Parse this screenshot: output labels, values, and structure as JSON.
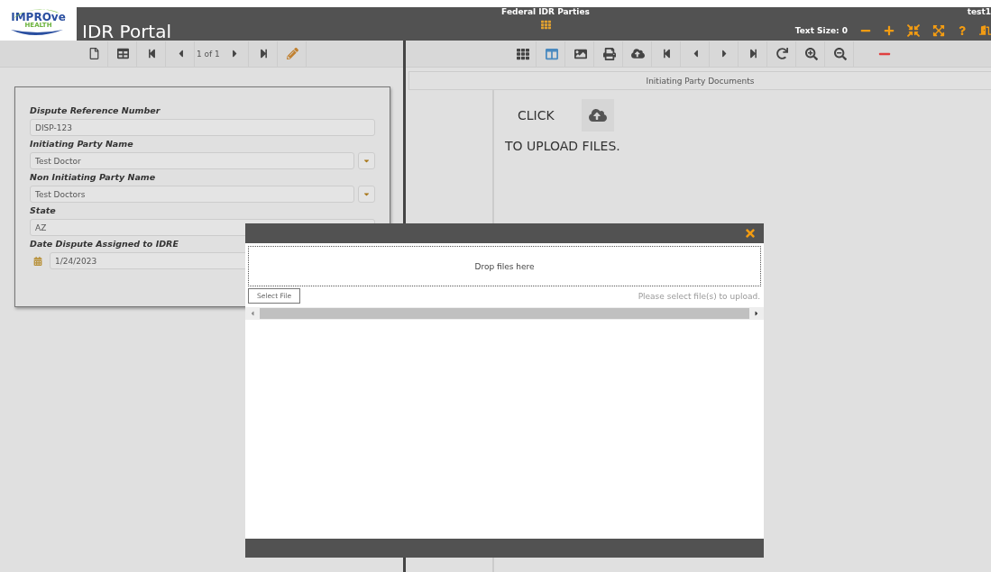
{
  "logo": {
    "brand": "IMPROve",
    "sub": "HEALTH"
  },
  "header": {
    "title": "IDR Portal",
    "section": "Federal IDR Parties",
    "text_size": "Text Size: 0",
    "user": "test1"
  },
  "left_toolbar": {
    "pager": "1 of 1"
  },
  "right_toolbar": {
    "split_view_selected": true
  },
  "form": {
    "fields": [
      {
        "kind": "text",
        "label": "Dispute Reference Number",
        "value": "DISP-123"
      },
      {
        "kind": "select",
        "label": "Initiating Party Name",
        "value": "Test Doctor"
      },
      {
        "kind": "select",
        "label": "Non Initiating Party Name",
        "value": "Test Doctors"
      },
      {
        "kind": "text",
        "label": "State",
        "value": "AZ"
      },
      {
        "kind": "date",
        "label": "Date Dispute Assigned to IDRE",
        "value": "1/24/2023"
      }
    ]
  },
  "documents": {
    "title": "Initiating Party Documents",
    "click": "CLICK",
    "upload_text": "TO UPLOAD FILES."
  },
  "upload_dialog": {
    "drop_text": "Drop files here",
    "select_button": "Select File",
    "hint": "Please select file(s) to upload."
  }
}
